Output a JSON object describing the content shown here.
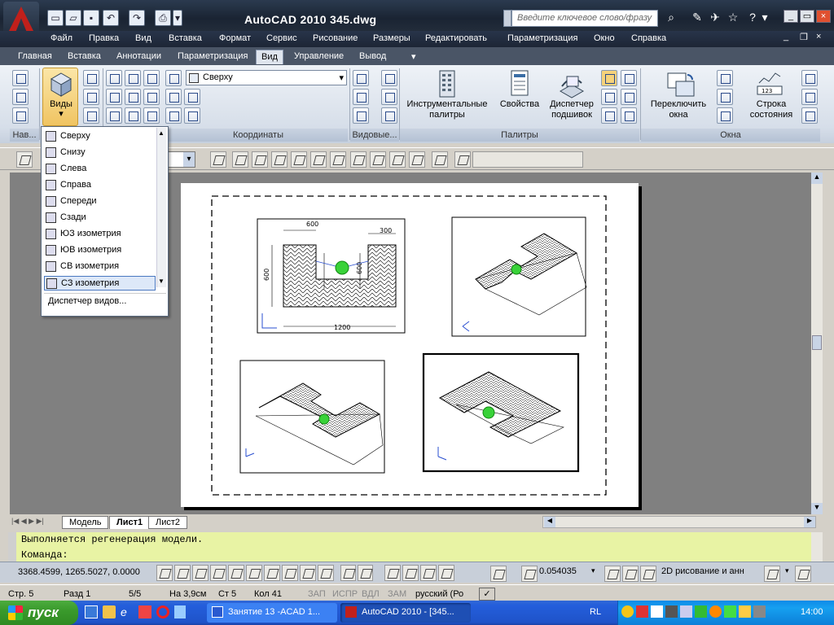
{
  "window": {
    "title": "AutoCAD 2010     345.dwg"
  },
  "search": {
    "placeholder": "Введите ключевое слово/фразу"
  },
  "menu": [
    "Файл",
    "Правка",
    "Вид",
    "Вставка",
    "Формат",
    "Сервис",
    "Рисование",
    "Размеры",
    "Редактировать",
    "Параметризация",
    "Окно",
    "Справка"
  ],
  "ribbon_tabs": [
    "Главная",
    "Вставка",
    "Аннотации",
    "Параметризация",
    "Вид",
    "Управление",
    "Вывод"
  ],
  "active_tab": "Вид",
  "ribbon": {
    "views_label": "Виды",
    "view_combo": "Сверху",
    "tool_palettes": "Инструментальные палитры",
    "properties": "Свойства",
    "sheet_set": "Диспетчер подшивок",
    "switch_windows": "Переключить окна",
    "status_bar": "Строка состояния",
    "panels": {
      "nav": "Нав...",
      "coords": "Координаты",
      "viewports": "Видовые...",
      "palettes": "Палитры",
      "windows": "Окна"
    }
  },
  "views_dropdown": {
    "items": [
      "Сверху",
      "Снизу",
      "Слева",
      "Справа",
      "Спереди",
      "Сзади",
      "ЮЗ изометрия",
      "ЮВ изометрия",
      "СВ изометрия",
      "СЗ изометрия"
    ],
    "selected": "СЗ изометрия",
    "manager": "Диспетчер видов..."
  },
  "drawing": {
    "dim_600_top": "600",
    "dim_300": "300",
    "dim_600_left": "600",
    "dim_600_inner": "600",
    "dim_1200": "1200"
  },
  "sheet_tabs": [
    "Модель",
    "Лист1",
    "Лист2"
  ],
  "command": {
    "line1": "Выполняется регенерация модели.",
    "line2": "Команда:"
  },
  "status": {
    "coords": "3368.4599, 1265.5027, 0.0000",
    "scale": "0.054035",
    "workspace": "2D рисование и анн"
  },
  "word_status": {
    "page": "Стр. 5",
    "section": "Разд 1",
    "pages": "5/5",
    "at": "На 3,9см",
    "line": "Ст 5",
    "col": "Кол 41",
    "rec": "ЗАП",
    "trk": "ИСПР",
    "ext": "ВДЛ",
    "ovr": "ЗАМ",
    "lang": "русский (Ро"
  },
  "taskbar": {
    "start": "пуск",
    "tasks": [
      "Занятие 13 -ACAD 1...",
      "AutoCAD 2010 - [345..."
    ],
    "lang": "RL",
    "clock": "14:00"
  },
  "colors": {
    "accent": "#3a6ea5",
    "command_bg": "#e8f3a4",
    "highlight": "#39d239"
  }
}
